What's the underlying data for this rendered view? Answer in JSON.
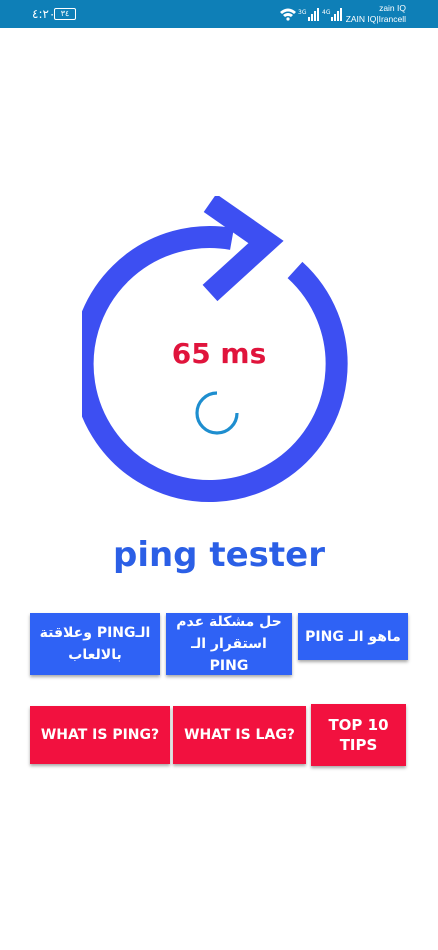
{
  "status_bar": {
    "time": "٤:٢٠",
    "battery": "٣٤",
    "network_1": "3G",
    "network_2": "4G",
    "carrier_1": "zain IQ",
    "carrier_2": "ZAIN IQ|Irancell"
  },
  "main": {
    "ping_value": "65 ms",
    "app_title": "ping tester",
    "ring_color": "#3d4ff2",
    "spinner_color": "#1e8ecf"
  },
  "buttons_row1": [
    {
      "label": "الـPING وعلاقتة بالالعاب"
    },
    {
      "label": "حل مشكلة عدم استقرار الـ PING"
    },
    {
      "label": "ماهو الـ PING"
    }
  ],
  "buttons_row2": [
    {
      "label": "WHAT IS PING?"
    },
    {
      "label": "WHAT IS LAG?"
    },
    {
      "label": "TOP 10 TIPS"
    }
  ]
}
